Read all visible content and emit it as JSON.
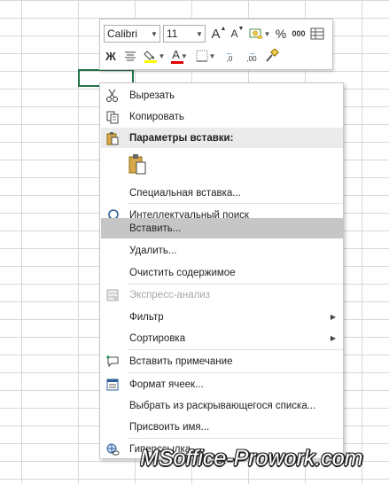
{
  "mini_toolbar": {
    "font_name": "Calibri",
    "font_size": "11",
    "grow_font": "A",
    "shrink_font": "A",
    "percent": "%",
    "thousands": "000",
    "bold": "Ж",
    "font_color_letter": "A",
    "decrease_decimal": "←,0",
    "increase_decimal": ",00",
    "icons": [
      "increase-font-icon",
      "decrease-font-icon",
      "accounting-format-icon",
      "percent-icon",
      "comma-style-icon",
      "format-table-icon",
      "bold-icon",
      "align-center-icon",
      "fill-color-icon",
      "font-color-icon",
      "borders-icon",
      "decrease-decimal-icon",
      "increase-decimal-icon",
      "format-painter-icon"
    ],
    "colors": {
      "fill_color": "#ffff00",
      "font_color": "#e00000"
    }
  },
  "menu": {
    "cut": "Вырезать",
    "copy": "Копировать",
    "paste_options": "Параметры вставки:",
    "paste_special": "Специальная вставка...",
    "smart_lookup": "Интеллектуальный поиск",
    "insert": "Вставить...",
    "delete": "Удалить...",
    "clear_contents": "Очистить содержимое",
    "quick_analysis": "Экспресс-анализ",
    "filter": "Фильтр",
    "sort": "Сортировка",
    "insert_comment": "Вставить примечание",
    "format_cells": "Формат ячеек...",
    "pick_from_list": "Выбрать из раскрывающегося списка...",
    "define_name": "Присвоить имя...",
    "hyperlink": "Гиперссылка..."
  },
  "watermark": "MSoffice-Prowork.com",
  "colors": {
    "accent": "#217346",
    "highlight": "#c6c6c6",
    "header": "#ebebeb"
  }
}
